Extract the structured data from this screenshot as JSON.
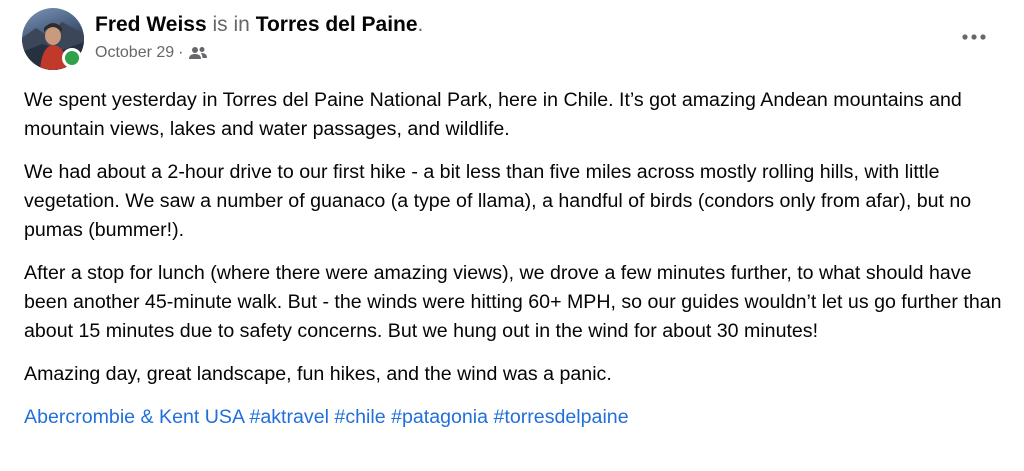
{
  "post": {
    "author_name": "Fred Weiss",
    "is_in_text": "is in",
    "location": "Torres del Paine",
    "period": ".",
    "date": "October 29",
    "date_separator": "·",
    "audience_icon": "friends-icon",
    "more_icon": "more-options-icon",
    "online_status_color": "#31a24c",
    "paragraphs": [
      "We spent yesterday in Torres del Paine National Park, here in Chile.  It’s got amazing Andean mountains and mountain views, lakes and water passages, and wildlife.",
      "We had about a 2-hour drive to our first hike - a bit less than five miles across mostly rolling hills, with little vegetation.  We saw a number of guanaco (a type of llama), a handful of birds (condors only from afar), but no pumas (bummer!).",
      "After a stop for lunch (where there were amazing views), we drove a few minutes further, to what should have been another 45-minute walk. But - the winds were hitting 60+ MPH, so our guides wouldn’t let us go further than about 15 minutes due to safety concerns.  But we hung out in the wind for about 30 minutes!",
      "Amazing day, great landscape, fun hikes, and the wind was a panic."
    ],
    "tags": [
      "Abercrombie & Kent USA",
      "#aktravel",
      "#chile",
      "#patagonia",
      "#torresdelpaine"
    ],
    "link_color": "#216fdb"
  }
}
